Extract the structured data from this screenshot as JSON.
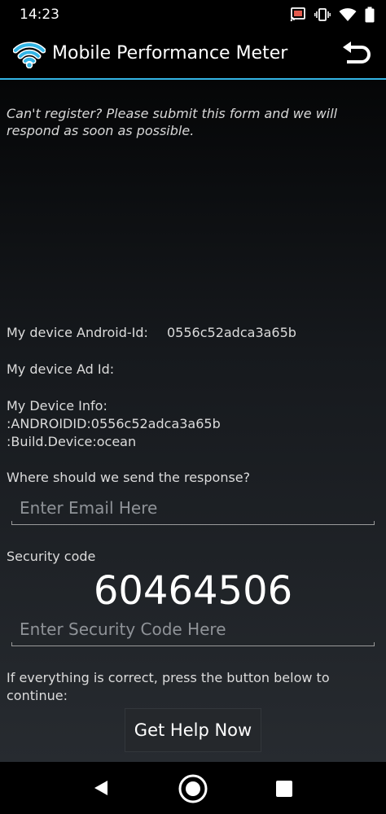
{
  "status_bar": {
    "time": "14:23",
    "icons": [
      "cast-icon",
      "vibrate-icon",
      "wifi-icon",
      "battery-icon"
    ]
  },
  "action_bar": {
    "title": "Mobile Performance Meter",
    "app_icon": "wifi-signal-icon",
    "back_icon": "undo-icon",
    "accent_color": "#33b5e5"
  },
  "form": {
    "intro": "Can't register? Please submit this form and we will respond as soon as possible.",
    "android_id_label": "My device Android-Id:",
    "android_id_value": "0556c52adca3a65b",
    "ad_id_label": "My device Ad Id:",
    "device_info_label": "My Device Info:",
    "device_info_line1": ":ANDROIDID:0556c52adca3a65b",
    "device_info_line2": ":Build.Device:ocean",
    "response_prompt": "Where should we send the response?",
    "email_placeholder": "Enter Email Here",
    "email_value": "",
    "security_label": "Security code",
    "security_code": "60464506",
    "security_placeholder": "Enter Security Code Here",
    "security_value": "",
    "continue_text_line1": "If everything is correct, press the button below to",
    "continue_text_line2": "continue:",
    "help_button": "Get Help Now"
  },
  "nav_bar": {
    "icons": [
      "back-triangle-icon",
      "home-circle-icon",
      "recents-square-icon"
    ]
  }
}
